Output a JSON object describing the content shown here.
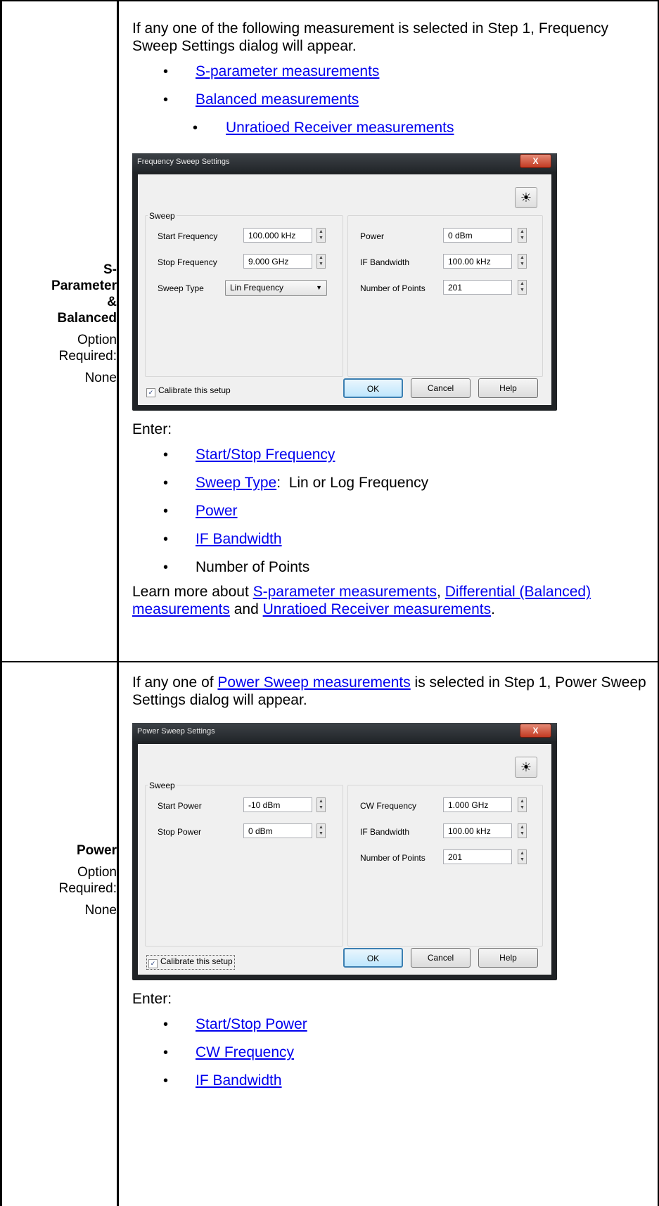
{
  "section1": {
    "label": {
      "title": [
        "S-",
        "Parameter",
        "&",
        "Balanced"
      ],
      "option_label": "Option Required:",
      "option_value": "None"
    },
    "intro": "If any one of the following measurement is selected in Step 1, Frequency Sweep Settings dialog will appear.",
    "measurement_links": [
      "S-parameter measurements",
      "Balanced measurements",
      "Unratioed Receiver measurements"
    ],
    "dialog": {
      "title": "Frequency Sweep Settings",
      "close_label": "X",
      "group_label": "Sweep",
      "start_freq_label": "Start Frequency",
      "start_freq_value": "100.000 kHz",
      "stop_freq_label": "Stop Frequency",
      "stop_freq_value": "9.000 GHz",
      "sweep_type_label": "Sweep Type",
      "sweep_type_value": "Lin Frequency",
      "power_label": "Power",
      "power_value": "0 dBm",
      "ifbw_label": "IF Bandwidth",
      "ifbw_value": "100.00 kHz",
      "points_label": "Number of Points",
      "points_value": "201",
      "calibrate_label": "Calibrate this setup",
      "ok_label": "OK",
      "cancel_label": "Cancel",
      "help_label": "Help"
    },
    "enter_label": "Enter:",
    "enter_items": {
      "start_stop": "Start/Stop Frequency",
      "sweep_type_link": "Sweep Type",
      "sweep_type_rest": ":  Lin or Log Frequency",
      "power": "Power",
      "ifbw": "IF Bandwidth",
      "points": "Number of Points"
    },
    "learn": {
      "prefix": "Learn more about ",
      "link1": "S-parameter measurements",
      "sep1": ", ",
      "link2": "Differential (Balanced) measurements",
      "sep2": " and ",
      "link3": "Unratioed Receiver measurements",
      "suffix": "."
    }
  },
  "section2": {
    "label": {
      "title": "Power",
      "option_label": "Option Required:",
      "option_value": "None"
    },
    "intro_prefix": "If any one of ",
    "intro_link": "Power Sweep measurements",
    "intro_suffix": " is selected in Step 1, Power Sweep Settings dialog will appear.",
    "dialog": {
      "title": "Power Sweep Settings",
      "close_label": "X",
      "group_label": "Sweep",
      "start_power_label": "Start Power",
      "start_power_value": "-10 dBm",
      "stop_power_label": "Stop Power",
      "stop_power_value": "0 dBm",
      "cw_label": "CW Frequency",
      "cw_value": "1.000 GHz",
      "ifbw_label": "IF Bandwidth",
      "ifbw_value": "100.00 kHz",
      "points_label": "Number of Points",
      "points_value": "201",
      "calibrate_label": "Calibrate this setup",
      "ok_label": "OK",
      "cancel_label": "Cancel",
      "help_label": "Help"
    },
    "enter_label": "Enter:",
    "enter_items": [
      "Start/Stop Power",
      "CW Frequency",
      "IF Bandwidth"
    ]
  }
}
